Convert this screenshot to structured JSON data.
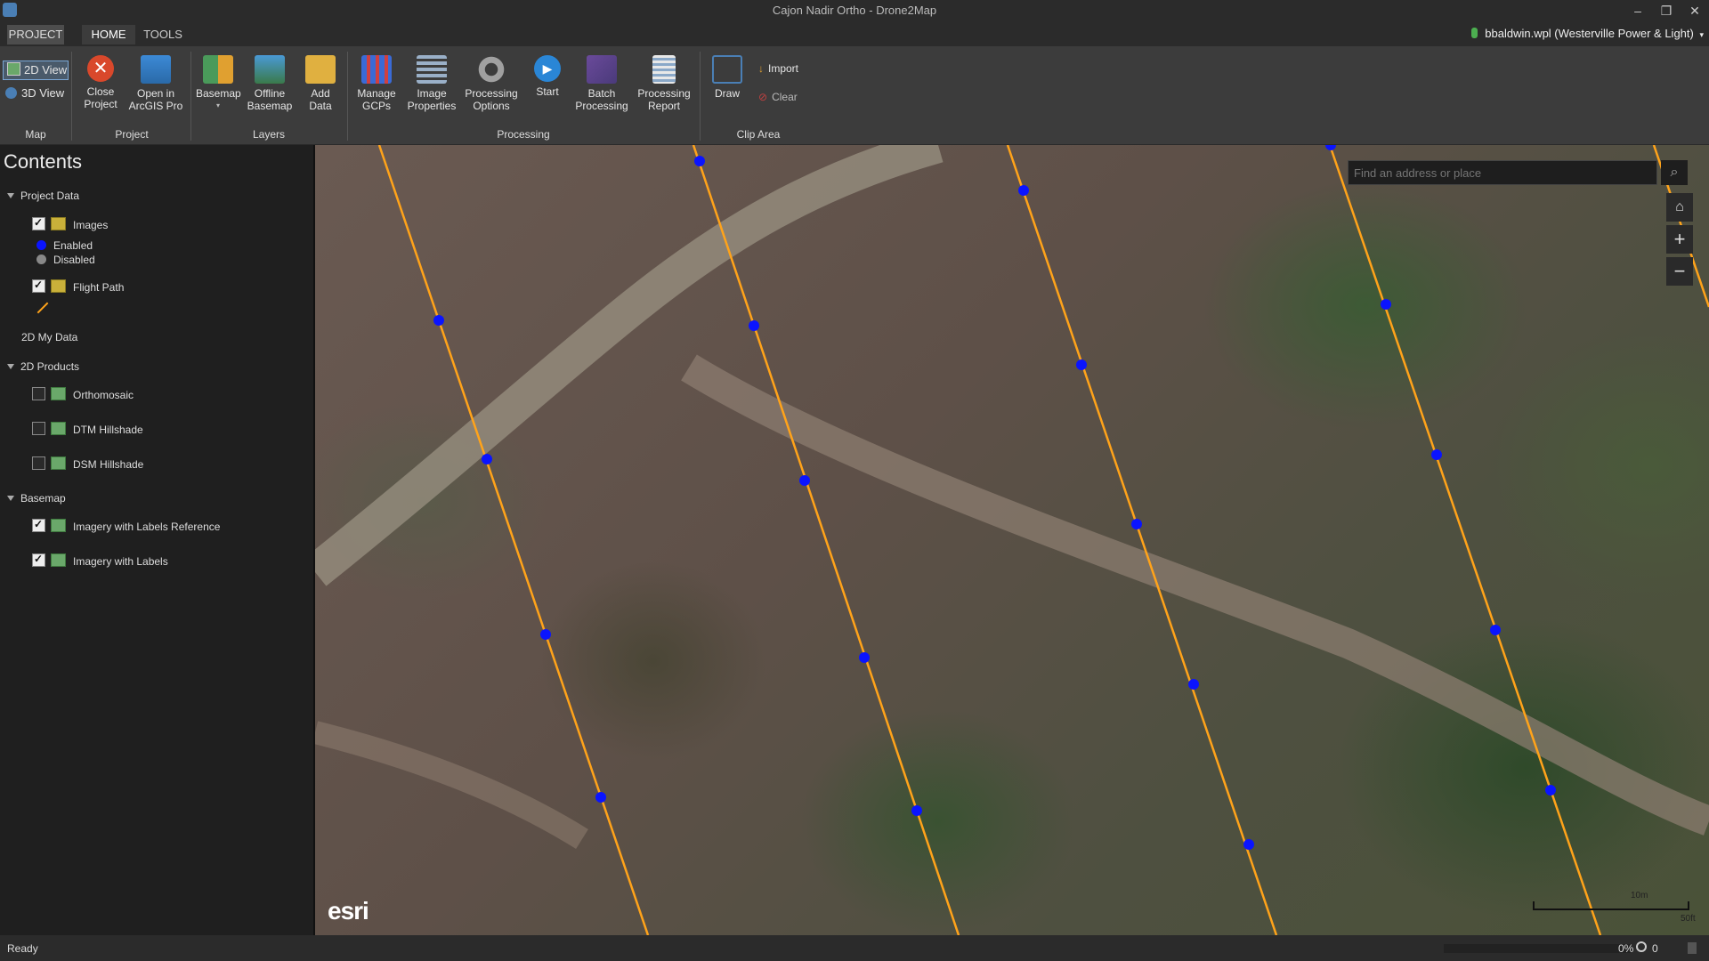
{
  "window": {
    "title": "Cajon Nadir Ortho - Drone2Map",
    "minimize": "–",
    "restore": "❐",
    "close": "✕"
  },
  "tabs": [
    {
      "label": "PROJECT"
    },
    {
      "label": "HOME"
    },
    {
      "label": "TOOLS"
    }
  ],
  "user": {
    "label": "bbaldwin.wpl (Westerville Power & Light)",
    "caret": "▾"
  },
  "ribbon": {
    "map": {
      "view2d": "2D View",
      "view3d": "3D View",
      "group": "Map"
    },
    "project": {
      "close": "Close\nProject",
      "open_arcgis": "Open in\nArcGIS Pro",
      "group": "Project"
    },
    "layers": {
      "basemap": "Basemap",
      "offline_basemap": "Offline\nBasemap",
      "add_data": "Add\nData",
      "group": "Layers"
    },
    "processing": {
      "manage_gcps": "Manage\nGCPs",
      "image_properties": "Image\nProperties",
      "processing_options": "Processing\nOptions",
      "start": "Start",
      "batch_processing": "Batch\nProcessing",
      "processing_report": "Processing\nReport",
      "group": "Processing"
    },
    "clip": {
      "draw": "Draw",
      "import": "Import",
      "clear": "Clear",
      "group": "Clip Area"
    }
  },
  "contents": {
    "title": "Contents",
    "project_data": "Project Data",
    "images": "Images",
    "enabled": "Enabled",
    "disabled": "Disabled",
    "flight_path": "Flight Path",
    "my_data": "2D My Data",
    "products": "2D Products",
    "orthomosaic": "Orthomosaic",
    "dtm": "DTM Hillshade",
    "dsm": "DSM Hillshade",
    "basemap": "Basemap",
    "imagery_labels_ref": "Imagery with Labels Reference",
    "imagery_labels": "Imagery with Labels"
  },
  "map": {
    "search_placeholder": "Find an address or place",
    "logo": "esri",
    "scale_metric": "10m",
    "scale_imperial": "50ft",
    "flight_line_color": "#ffa31a",
    "point_color": "#0a14ff"
  },
  "status": {
    "text": "Ready",
    "progress": 0,
    "progress_label": "0%",
    "job_count": "0"
  }
}
